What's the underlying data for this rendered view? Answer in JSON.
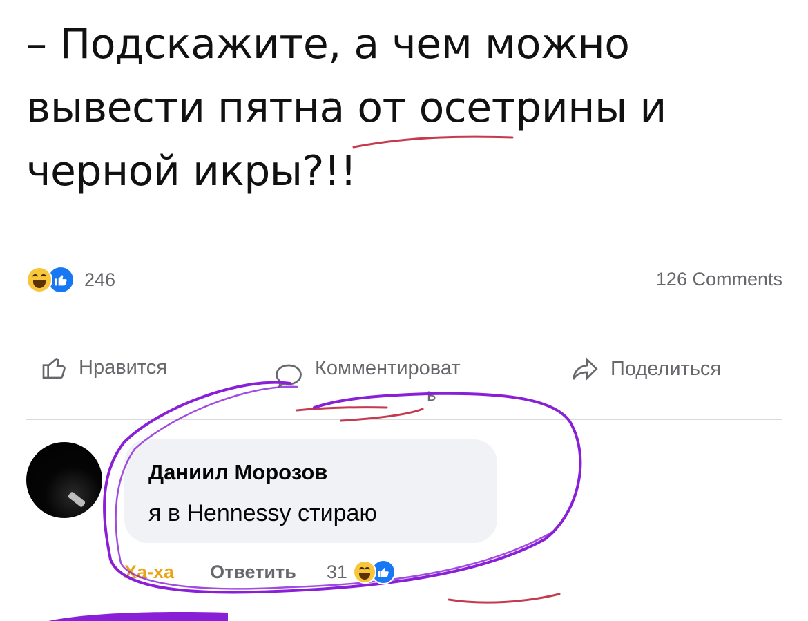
{
  "post": {
    "text_line1": "– Подскажите, а чем можно",
    "text_line2": "вывести пятна от осетрины и",
    "text_line3": "черной икры?!!"
  },
  "stats": {
    "reaction_icons": [
      "haha-emoji",
      "like-icon"
    ],
    "reaction_count": "246",
    "comments_label": "126 Comments"
  },
  "actions": {
    "like_label": "Нравится",
    "comment_label": "Комментироват",
    "comment_label_overflow": "ь",
    "share_label": "Поделиться"
  },
  "comment": {
    "author": "Даниил Морозов",
    "text": "я в Hennessy стираю",
    "haha_label": "Ха-ха",
    "reply_label": "Ответить",
    "reaction_count": "31"
  },
  "colors": {
    "like_blue": "#1877f2",
    "haha_yellow": "#f7c63b",
    "annotation_purple": "#8a1fd8",
    "annotation_red": "#c53a4e"
  }
}
